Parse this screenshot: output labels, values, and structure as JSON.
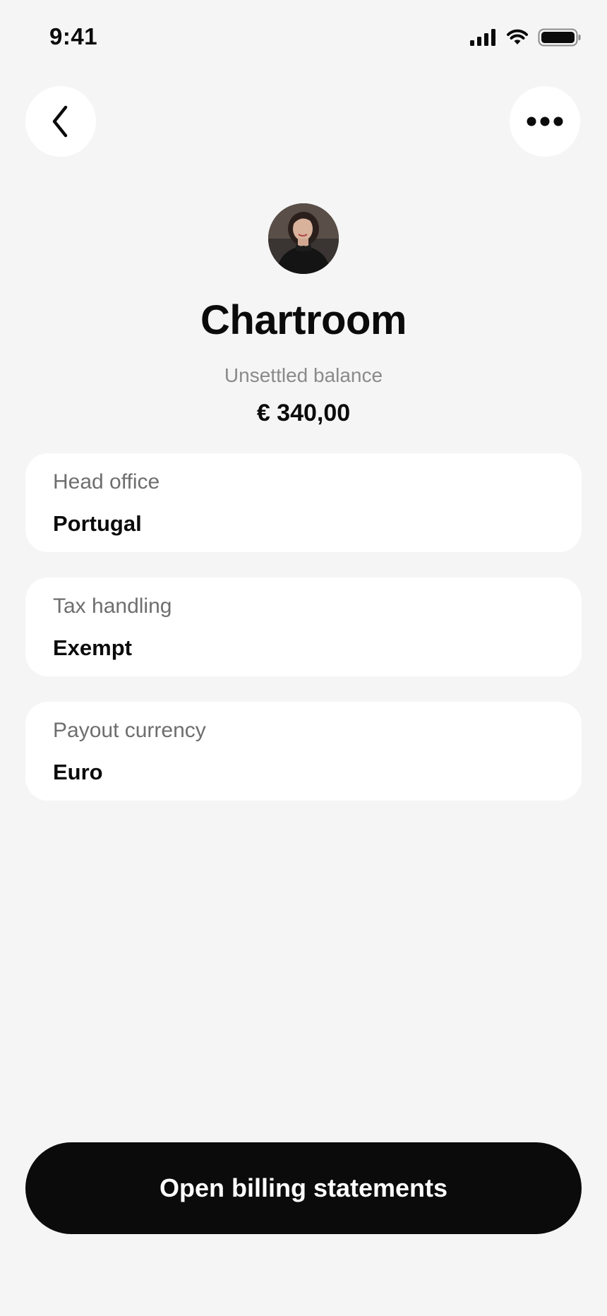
{
  "status_bar": {
    "time": "9:41",
    "icons": [
      "cellular-signal-icon",
      "wifi-icon",
      "battery-icon"
    ]
  },
  "header": {
    "back_icon": "chevron-left-icon",
    "more_icon": "more-horizontal-icon"
  },
  "profile": {
    "name": "Chartroom",
    "balance_label": "Unsettled balance",
    "balance_value": "€ 340,00"
  },
  "details": [
    {
      "label": "Head office",
      "value": "Portugal"
    },
    {
      "label": "Tax handling",
      "value": "Exempt"
    },
    {
      "label": "Payout currency",
      "value": "Euro"
    }
  ],
  "cta": {
    "label": "Open billing statements"
  },
  "colors": {
    "background": "#f5f5f5",
    "card": "#ffffff",
    "primary": "#0b0b0b",
    "muted": "#8a8a8a"
  }
}
